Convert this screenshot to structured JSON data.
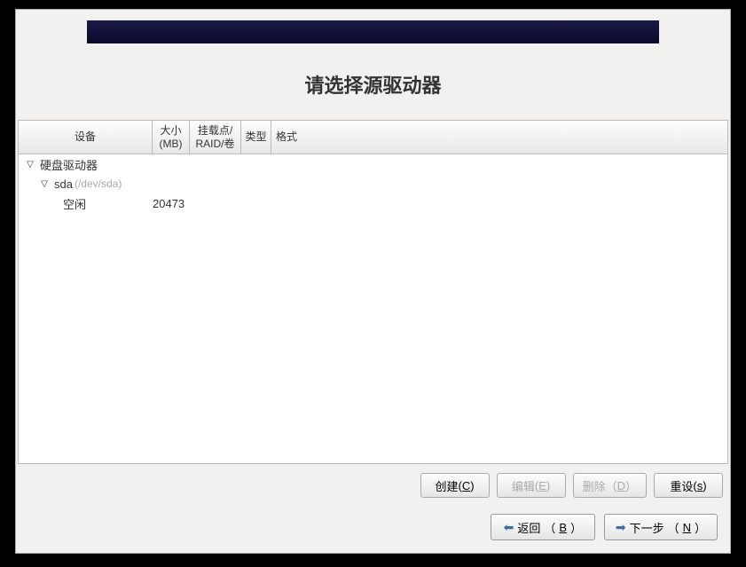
{
  "title": "请选择源驱动器",
  "columns": {
    "device": "设备",
    "size": "大小\n(MB)",
    "mount": "挂载点/\nRAID/卷",
    "type": "类型",
    "format": "格式"
  },
  "tree": {
    "root": "硬盘驱动器",
    "disk": "sda",
    "disk_path": "(/dev/sda)",
    "free_label": "空闲",
    "free_size": "20473"
  },
  "buttons": {
    "create": "创建",
    "create_mn": "C",
    "edit": "编辑",
    "edit_mn": "E",
    "delete": "删除",
    "delete_mn": "D",
    "reset": "重设",
    "reset_mn": "s",
    "back": "返回",
    "back_mn": "B",
    "next": "下一步",
    "next_mn": "N"
  }
}
